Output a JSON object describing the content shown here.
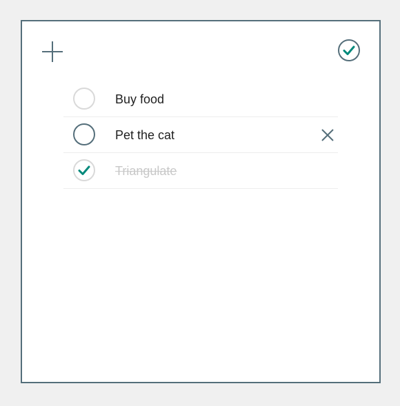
{
  "toolbar": {
    "add_icon": "plus-icon",
    "check_all_icon": "check-circle-icon"
  },
  "todos": [
    {
      "label": "Buy food",
      "completed": false,
      "hovered": false
    },
    {
      "label": "Pet the cat",
      "completed": false,
      "hovered": true
    },
    {
      "label": "Triangulate",
      "completed": true,
      "hovered": false
    }
  ],
  "colors": {
    "border": "#546e7a",
    "accent": "#00897b",
    "circle_idle": "#d9d9d9",
    "circle_hover": "#546e7a",
    "text": "#1f1f1f",
    "text_completed": "#c8c8c8"
  }
}
